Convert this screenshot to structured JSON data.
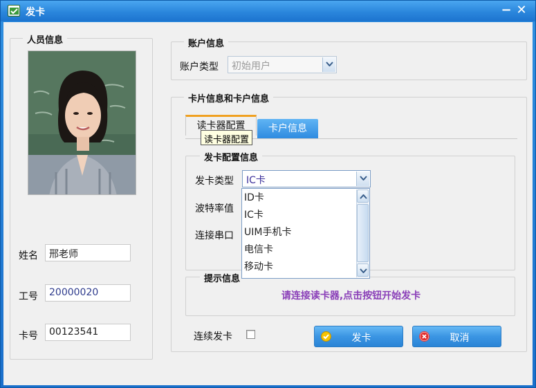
{
  "window": {
    "title": "发卡",
    "minimize_label": "−",
    "close_label": "✕"
  },
  "person": {
    "legend": "人员信息",
    "name_label": "姓名",
    "name_value": "邢老师",
    "id_label": "工号",
    "id_value": "20000020",
    "card_label": "卡号",
    "card_value": "00123541"
  },
  "account": {
    "legend": "账户信息",
    "type_label": "账户类型",
    "type_value": "初始用户"
  },
  "card": {
    "legend": "卡片信息和卡户信息",
    "tabs": [
      {
        "label": "读卡器配置"
      },
      {
        "label": "卡户信息"
      }
    ],
    "tooltip": "读卡器配置",
    "config": {
      "legend": "发卡配置信息",
      "card_type_label": "发卡类型",
      "card_type_value": "IC卡",
      "baud_label": "波特率值",
      "port_label": "连接串口",
      "options": [
        "ID卡",
        "IC卡",
        "UIM手机卡",
        "电信卡",
        "移动卡"
      ]
    },
    "tip": {
      "legend": "提示信息",
      "text": "请连接读卡器,点击按钮开始发卡"
    }
  },
  "footer": {
    "continuous_label": "连续发卡",
    "issue_button": "发卡",
    "cancel_button": "取消"
  },
  "icons": [
    "window-app-icon",
    "dropdown-arrow-icon",
    "scroll-up-icon",
    "scroll-down-icon",
    "checkmark-icon",
    "cancel-x-icon"
  ],
  "colors": {
    "titlebar": "#2a86dc",
    "tip_text": "#8a3fb8",
    "tab_active_accent": "#f0a020",
    "button": "#3b95e3"
  }
}
